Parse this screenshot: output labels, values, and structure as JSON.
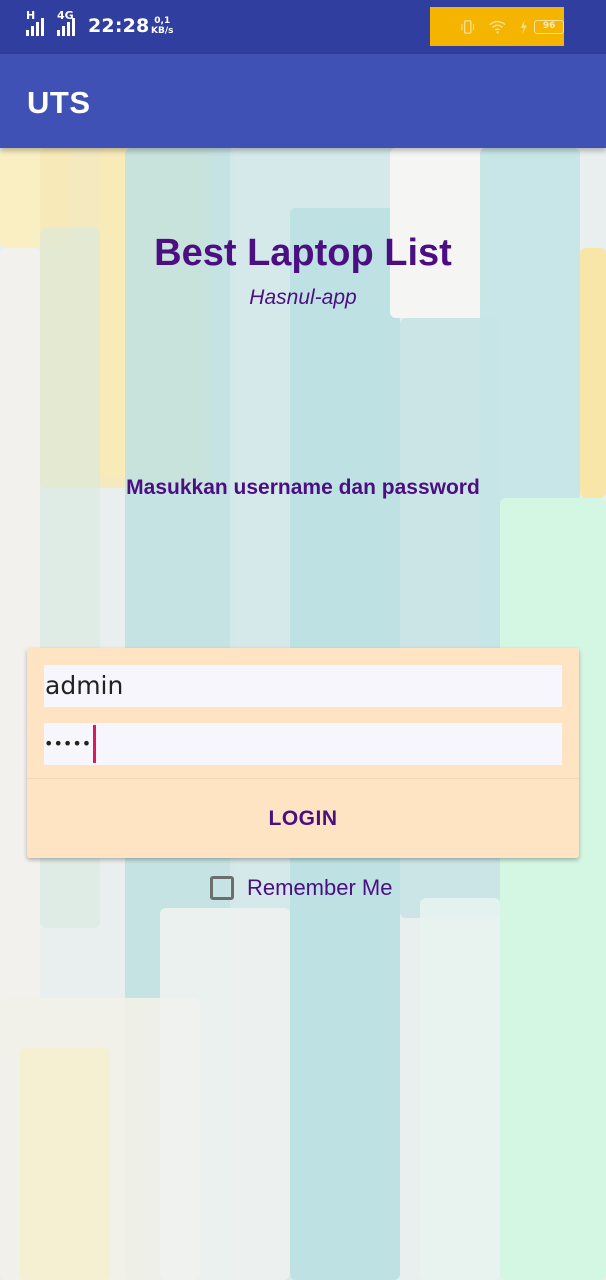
{
  "status_bar": {
    "network_type": "H",
    "network_type_2": "4G",
    "time": "22:28",
    "speed_value": "0,1",
    "speed_unit": "KB/s",
    "battery_level": "96",
    "icons": [
      "vibrate-icon",
      "wifi-icon",
      "charging-icon",
      "battery-icon"
    ],
    "background_color": "#303f9f",
    "highlight_color": "#f4b400"
  },
  "app_bar": {
    "title": "UTS",
    "color": "#3f51b5"
  },
  "main": {
    "heading": "Best Laptop List",
    "subheading": "Hasnul-app",
    "instruction": "Masukkan username dan password",
    "text_color": "#4b0f82"
  },
  "login_form": {
    "username_value": "admin",
    "password_masked": "•••••",
    "login_label": "LOGIN",
    "remember_label": "Remember Me",
    "remember_checked": false,
    "card_color": "#ffe4c4",
    "caret_color": "#d81b60"
  }
}
